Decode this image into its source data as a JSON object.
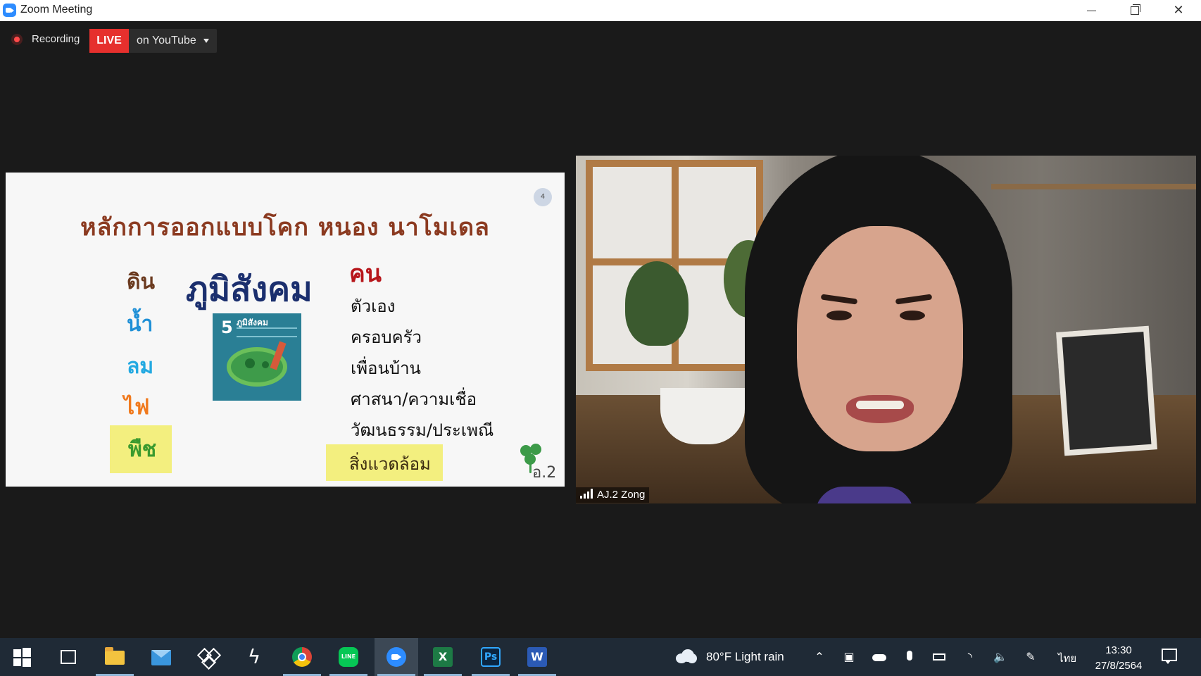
{
  "window": {
    "title": "Zoom Meeting"
  },
  "recording": {
    "label": "Recording",
    "live_badge": "LIVE",
    "live_destination": "on YouTube"
  },
  "slide": {
    "title": "หลักการออกแบบโคก หนอง นาโมเดล",
    "page_number": "4",
    "elements": [
      "ดิน",
      "น้ำ",
      "ลม",
      "ไฟ",
      "พืช"
    ],
    "main_word": "ภูมิสังคม",
    "book": {
      "number": "5",
      "title": "ภูมิสังคม"
    },
    "people_heading": "คน",
    "people_list": [
      "ตัวเอง",
      "ครอบครัว",
      "เพื่อนบ้าน",
      "ศาสนา/ความเชื่อ",
      "วัฒนธรรม/ประเพณี"
    ],
    "environment": "สิ่งแวดล้อม",
    "signature": "อ.2"
  },
  "participant": {
    "name": "AJ.2 Zong"
  },
  "taskbar": {
    "weather": {
      "temperature": "80°F",
      "condition": "Light rain"
    },
    "language": "ไทย",
    "time": "13:30",
    "date": "27/8/2564"
  },
  "colors": {
    "live": "#e6302d",
    "zoom": "#2d8cff",
    "taskbar": "#1f2a36"
  }
}
